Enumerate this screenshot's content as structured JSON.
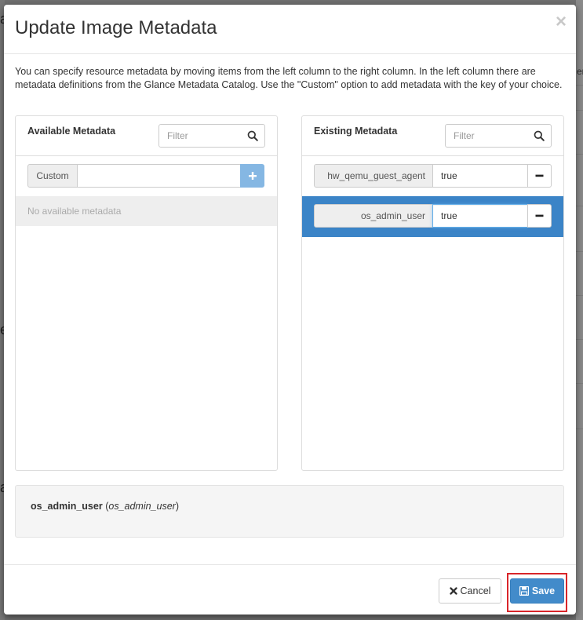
{
  "modal": {
    "title": "Update Image Metadata",
    "close_glyph": "×",
    "description": "You can specify resource metadata by moving items from the left column to the right column. In the left column there are metadata definitions from the Glance Metadata Catalog. Use the \"Custom\" option to add metadata with the key of your choice."
  },
  "available": {
    "heading": "Available Metadata",
    "filter_placeholder": "Filter",
    "custom_label": "Custom",
    "custom_value": "",
    "add_icon": "plus-icon",
    "empty_text": "No available metadata"
  },
  "existing": {
    "heading": "Existing Metadata",
    "filter_placeholder": "Filter",
    "items": [
      {
        "key": "hw_qemu_guest_agent",
        "value": "true",
        "selected": false
      },
      {
        "key": "os_admin_user",
        "value": "true",
        "selected": true
      }
    ],
    "remove_icon": "minus-icon"
  },
  "info": {
    "key": "os_admin_user",
    "name": "os_admin_user"
  },
  "footer": {
    "cancel_label": "Cancel",
    "save_label": "Save"
  },
  "colors": {
    "primary": "#428bca",
    "selected_row": "#3b84c7",
    "highlight": "#d9252a"
  },
  "background": {
    "left_chars": [
      "a",
      "e",
      "a"
    ],
    "right_text": "er"
  }
}
